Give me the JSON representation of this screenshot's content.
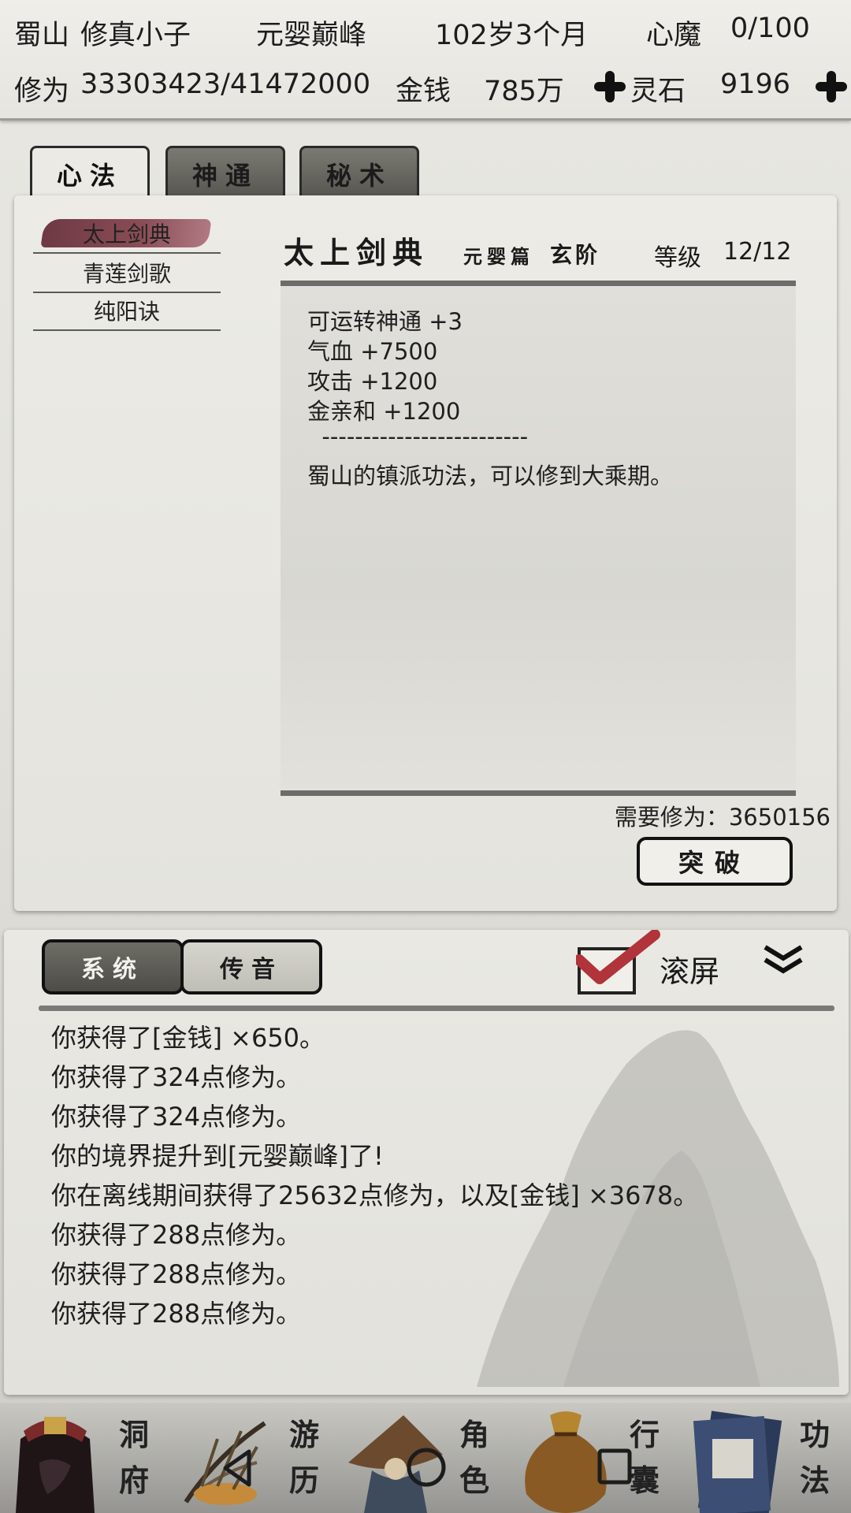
{
  "status": {
    "sect": "蜀山",
    "name": "修真小子",
    "realm": "元婴巅峰",
    "age": "102岁3个月",
    "demon_label": "心魔",
    "demon_value": "0/100",
    "cultivation_label": "修为",
    "cultivation_value": "33303423/41472000",
    "money_label": "金钱",
    "money_value": "785万",
    "stone_label": "灵石",
    "stone_value": "9196"
  },
  "tabs": [
    {
      "label": "心法",
      "active": true
    },
    {
      "label": "神通",
      "active": false
    },
    {
      "label": "秘术",
      "active": false
    }
  ],
  "techniques": [
    {
      "name": "太上剑典",
      "selected": true
    },
    {
      "name": "青莲剑歌",
      "selected": false
    },
    {
      "name": "纯阳诀",
      "selected": false
    }
  ],
  "detail": {
    "title": "太上剑典",
    "subtitle": "元婴篇",
    "grade": "玄阶",
    "level_label": "等级",
    "level_value": "12/12",
    "lines": [
      "可运转神通 +3",
      "气血 +7500",
      "攻击 +1200",
      "金亲和 +1200",
      "  -------------------------",
      "蜀山的镇派功法，可以修到大乘期。"
    ],
    "need_label": "需要修为：",
    "need_value": "3650156",
    "breakthrough_label": "突破"
  },
  "log": {
    "tab_system": "系统",
    "tab_voice": "传音",
    "scroll_label": "滚屏",
    "scroll_checked": true,
    "messages": [
      "你获得了[金钱] ×650。",
      "你获得了324点修为。",
      "你获得了324点修为。",
      "你的境界提升到[元婴巅峰]了!",
      "你在离线期间获得了25632点修为，以及[金钱] ×3678。",
      "你获得了288点修为。",
      "你获得了288点修为。",
      "你获得了288点修为。"
    ]
  },
  "nav": [
    {
      "label_top": "洞",
      "label_bottom": "府",
      "icon": "dongfu-icon"
    },
    {
      "label_top": "游",
      "label_bottom": "历",
      "icon": "travel-icon"
    },
    {
      "label_top": "角",
      "label_bottom": "色",
      "icon": "character-icon"
    },
    {
      "label_top": "行",
      "label_bottom": "囊",
      "icon": "bag-icon"
    },
    {
      "label_top": "功",
      "label_bottom": "法",
      "icon": "technique-book-icon"
    }
  ],
  "colors": {
    "accent": "#7a3f49",
    "check": "#b0343a"
  }
}
